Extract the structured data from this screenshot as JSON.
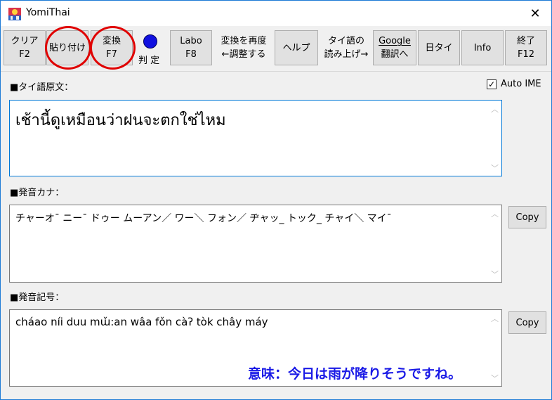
{
  "window": {
    "title": "YomiThai"
  },
  "toolbar": {
    "clear": {
      "line1": "クリア",
      "line2": "F2"
    },
    "paste": {
      "line1": "貼り付け"
    },
    "convert": {
      "line1": "変換",
      "line2": "F7"
    },
    "judge_label": "判 定",
    "labo": {
      "line1": "Labo",
      "line2": "F8"
    },
    "readjust": {
      "line1": "変換を再度",
      "line2": "←調整する"
    },
    "help": {
      "line1": "ヘルプ"
    },
    "read_aloud": {
      "line1": "タイ語の",
      "line2": "読み上げ→"
    },
    "google": {
      "line1": "Google",
      "line2": "翻訳へ"
    },
    "jp_thai": {
      "line1": "日タイ"
    },
    "info": {
      "line1": "Info"
    },
    "exit": {
      "line1": "終了",
      "line2": "F12"
    }
  },
  "source": {
    "label": "■タイ語原文：",
    "text": "เช้านี้ดูเหมือนว่าฝนจะตกใช่ไหม",
    "auto_ime_label": "Auto IME",
    "auto_ime_checked": true
  },
  "kana": {
    "label": "■発音カナ：",
    "text": "チャーオ¯ ニー¯ ドゥー ムーアン／ ワー＼ フォン／ ヂャッ_ トック_ チャイ＼ マイ¯",
    "copy_label": "Copy"
  },
  "symbols": {
    "label": "■発音記号：",
    "text": "cháao níi duu mɯ̌:an wâa fǒn càʔ tòk chây máy",
    "copy_label": "Copy"
  },
  "meaning_note": "意味：今日は雨が降りそうですね。",
  "colors": {
    "accent": "#0078d7",
    "annotation": "#1a1ae6",
    "highlight_ring": "#e00000",
    "lamp": "#1010e0"
  }
}
